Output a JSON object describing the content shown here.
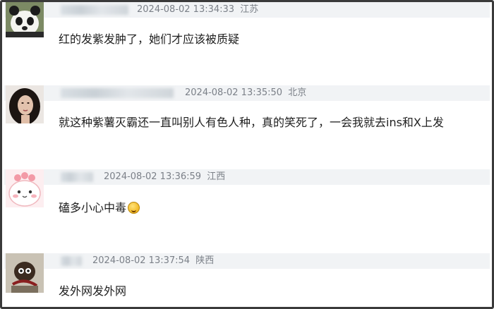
{
  "comments": [
    {
      "avatar": "panda-avatar",
      "timestamp": "2024-08-02 13:34:33",
      "location": "江苏",
      "text": "红的发紫发肿了，她们才应该被质疑"
    },
    {
      "avatar": "woman-portrait-avatar",
      "timestamp": "2024-08-02 13:35:50",
      "location": "北京",
      "text": "就这种紫薯灭霸还一直叫别人有色人种，真的笑死了，一会我就去ins和X上发"
    },
    {
      "avatar": "pink-cartoon-avatar",
      "timestamp": "2024-08-02 13:36:59",
      "location": "江西",
      "text": "磕多小心中毒",
      "emoji": "laughing-emoji-icon"
    },
    {
      "avatar": "cartoon-character-avatar",
      "timestamp": "2024-08-02 13:37:54",
      "location": "陕西",
      "text": "发外网发外网"
    }
  ]
}
